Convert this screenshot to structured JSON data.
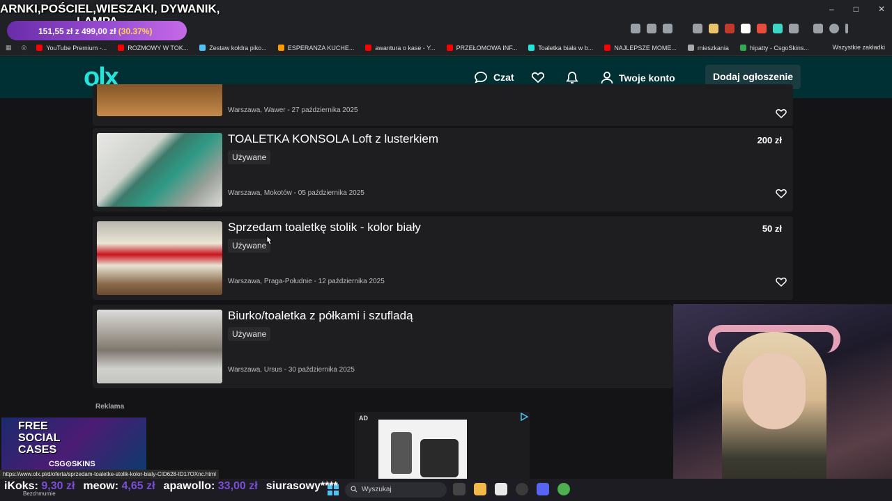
{
  "stream_overlay": {
    "title_line1": "ARNKI,POŚCIEL,WIESZAKI, DYWANIK,",
    "title_line2": "LAMPA",
    "donation_amount": "151,55 zł",
    "donation_goal": "z 499,00 zł",
    "donation_percent": "(30.37%)",
    "ticker": [
      {
        "name": "iKoks:",
        "amount": "9,30 zł"
      },
      {
        "name": "meow:",
        "amount": "4,65 zł"
      },
      {
        "name": "apawollo:",
        "amount": "33,00 zł"
      },
      {
        "name": "siurasowy****",
        "amount": ""
      }
    ],
    "streamer_name": "Bezchmurnie",
    "promo": {
      "line1": "FREE",
      "line2": "SOCIAL",
      "line3": "CASES",
      "brand": "CSG⊙SKINS"
    }
  },
  "browser": {
    "window_controls": [
      "–",
      "□",
      "✕"
    ],
    "bookmarks": [
      {
        "label": "YouTube Premium -...",
        "color": "#ff0000"
      },
      {
        "label": "ROZMOWY W TOK...",
        "color": "#ff0000"
      },
      {
        "label": "Zestaw kołdra piko...",
        "color": "#4fc3f7"
      },
      {
        "label": "ESPERANZA KUCHE...",
        "color": "#ff9900"
      },
      {
        "label": "awantura o kase - Y...",
        "color": "#ff0000"
      },
      {
        "label": "PRZEŁOMOWA INF...",
        "color": "#ff0000"
      },
      {
        "label": "Toaletka biała w b...",
        "color": "#23e5db"
      },
      {
        "label": "NAJLEPSZE MOME...",
        "color": "#ff0000"
      },
      {
        "label": "mieszkania",
        "color": "#aaaaaa"
      },
      {
        "label": "hipatty - CsgoSkins...",
        "color": "#34a853"
      }
    ],
    "all_bookmarks": "Wszystkie zakładki",
    "status_url": "https://www.olx.pl/d/oferta/sprzedam-toaletke-stolik-kolor-bialy-CID628-ID17OXnc.html"
  },
  "olx": {
    "logo": "olx",
    "chat": "Czat",
    "account": "Twoje konto",
    "add_listing": "Dodaj ogłoszenie",
    "accent": "#23e5db",
    "listings": [
      {
        "title": "",
        "condition": "",
        "location": "Warszawa, Wawer - 27 października 2025",
        "price": ""
      },
      {
        "title": "TOALETKA KONSOLA Loft z lusterkiem",
        "condition": "Używane",
        "location": "Warszawa, Mokotów - 05 października 2025",
        "price": "200 zł"
      },
      {
        "title": "Sprzedam toaletkę stolik - kolor biały",
        "condition": "Używane",
        "location": "Warszawa, Praga-Południe - 12 października 2025",
        "price": "50 zł"
      },
      {
        "title": "Biurko/toaletka z półkami i szufladą",
        "condition": "Używane",
        "location": "Warszawa, Ursus - 30 października 2025",
        "price": ""
      }
    ],
    "ad_section": "Reklama",
    "ad_label": "AD"
  },
  "taskbar": {
    "search_placeholder": "Wyszukaj"
  }
}
